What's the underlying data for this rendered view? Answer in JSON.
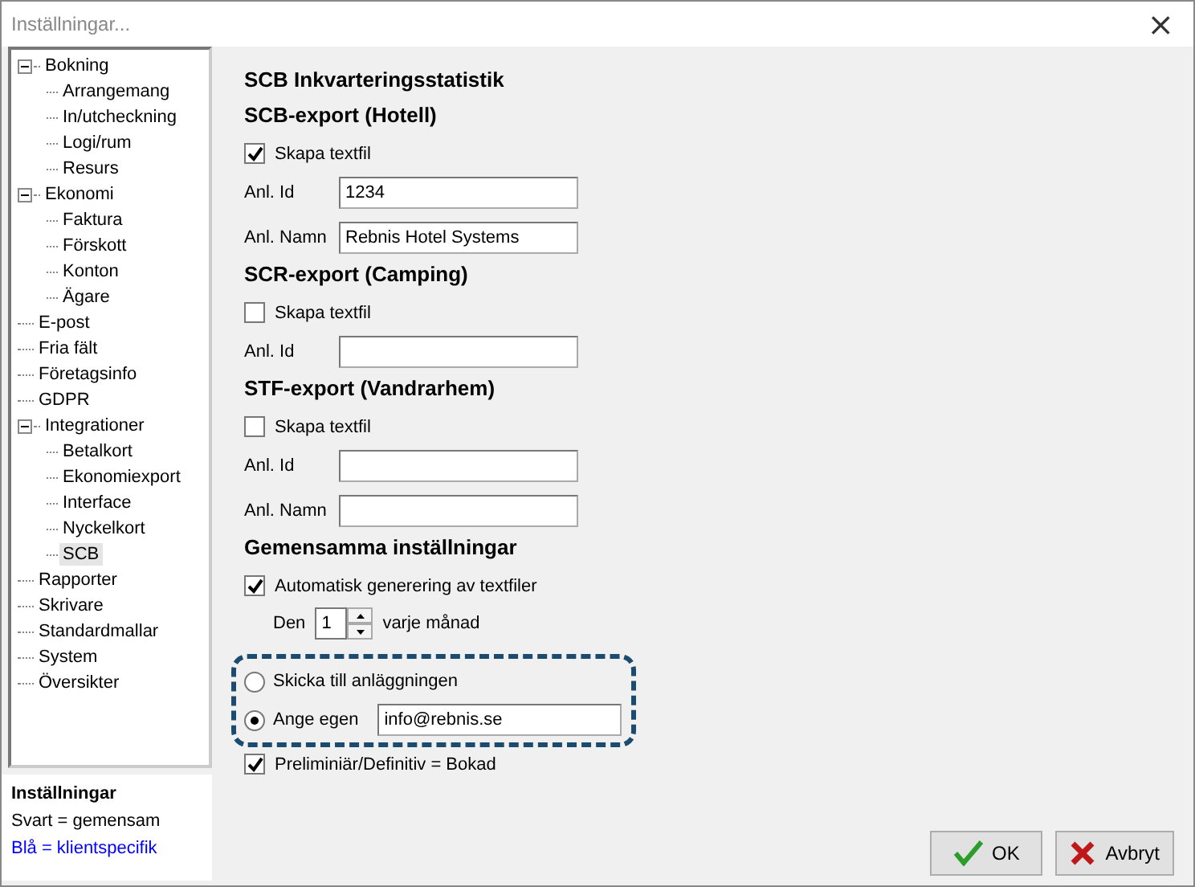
{
  "window": {
    "title": "Inställningar...",
    "close": "×"
  },
  "tree": [
    {
      "label": "Bokning",
      "expanded": true,
      "selected": false,
      "children": [
        {
          "label": "Arrangemang",
          "selected": false
        },
        {
          "label": "In/utcheckning",
          "selected": false
        },
        {
          "label": "Logi/rum",
          "selected": false
        },
        {
          "label": "Resurs",
          "selected": false
        }
      ]
    },
    {
      "label": "Ekonomi",
      "expanded": true,
      "selected": false,
      "children": [
        {
          "label": "Faktura",
          "selected": false
        },
        {
          "label": "Förskott",
          "selected": false
        },
        {
          "label": "Konton",
          "selected": false
        },
        {
          "label": "Ägare",
          "selected": false
        }
      ]
    },
    {
      "label": "E-post",
      "selected": false
    },
    {
      "label": "Fria fält",
      "selected": false
    },
    {
      "label": "Företagsinfo",
      "selected": false
    },
    {
      "label": "GDPR",
      "selected": false
    },
    {
      "label": "Integrationer",
      "expanded": true,
      "selected": false,
      "children": [
        {
          "label": "Betalkort",
          "selected": false
        },
        {
          "label": "Ekonomiexport",
          "selected": false
        },
        {
          "label": "Interface",
          "selected": false
        },
        {
          "label": "Nyckelkort",
          "selected": false
        },
        {
          "label": "SCB",
          "selected": true
        }
      ]
    },
    {
      "label": "Rapporter",
      "selected": false
    },
    {
      "label": "Skrivare",
      "selected": false
    },
    {
      "label": "Standardmallar",
      "selected": false
    },
    {
      "label": "System",
      "selected": false
    },
    {
      "label": "Översikter",
      "selected": false
    }
  ],
  "legend": {
    "title": "Inställningar",
    "lines": [
      {
        "text": "Svart = gemensam",
        "color": "#000000"
      },
      {
        "text": "Blå = klientspecifik",
        "color": "#0000ff"
      }
    ]
  },
  "page_title": "SCB Inkvarteringsstatistik",
  "sections": [
    {
      "heading": "SCB-export (Hotell)",
      "items": [
        {
          "kind": "checkbox",
          "label": "Skapa textfil",
          "checked": true
        },
        {
          "kind": "field",
          "label": "Anl. Id",
          "value": "1234"
        },
        {
          "kind": "field",
          "label": "Anl. Namn",
          "value": "Rebnis Hotel Systems"
        }
      ]
    },
    {
      "heading": "SCR-export (Camping)",
      "items": [
        {
          "kind": "checkbox",
          "label": "Skapa textfil",
          "checked": false
        },
        {
          "kind": "field",
          "label": "Anl. Id"
        }
      ]
    },
    {
      "heading": "STF-export (Vandrarhem)",
      "items": [
        {
          "kind": "checkbox",
          "label": "Skapa textfil",
          "checked": false
        },
        {
          "kind": "field",
          "label": "Anl. Id"
        },
        {
          "kind": "field",
          "label": "Anl. Namn"
        }
      ]
    },
    {
      "heading": "Gemensamma inställningar",
      "items": [
        {
          "kind": "checkbox",
          "label": "Automatisk generering av textfiler",
          "checked": true
        },
        {
          "kind": "spinner",
          "before": "Den",
          "value": "1",
          "after": "varje månad"
        }
      ]
    }
  ],
  "recipient": [
    {
      "label": "Skicka till anläggningen",
      "selected": false
    },
    {
      "label": "Ange egen",
      "selected": true,
      "value": "info@rebnis.se"
    }
  ],
  "final_check": {
    "label": "Preliminiär/Definitiv = Bokad",
    "checked": true
  },
  "buttons": [
    {
      "kind": "ok",
      "label": "OK"
    },
    {
      "kind": "cancel",
      "label": "Avbryt"
    }
  ]
}
